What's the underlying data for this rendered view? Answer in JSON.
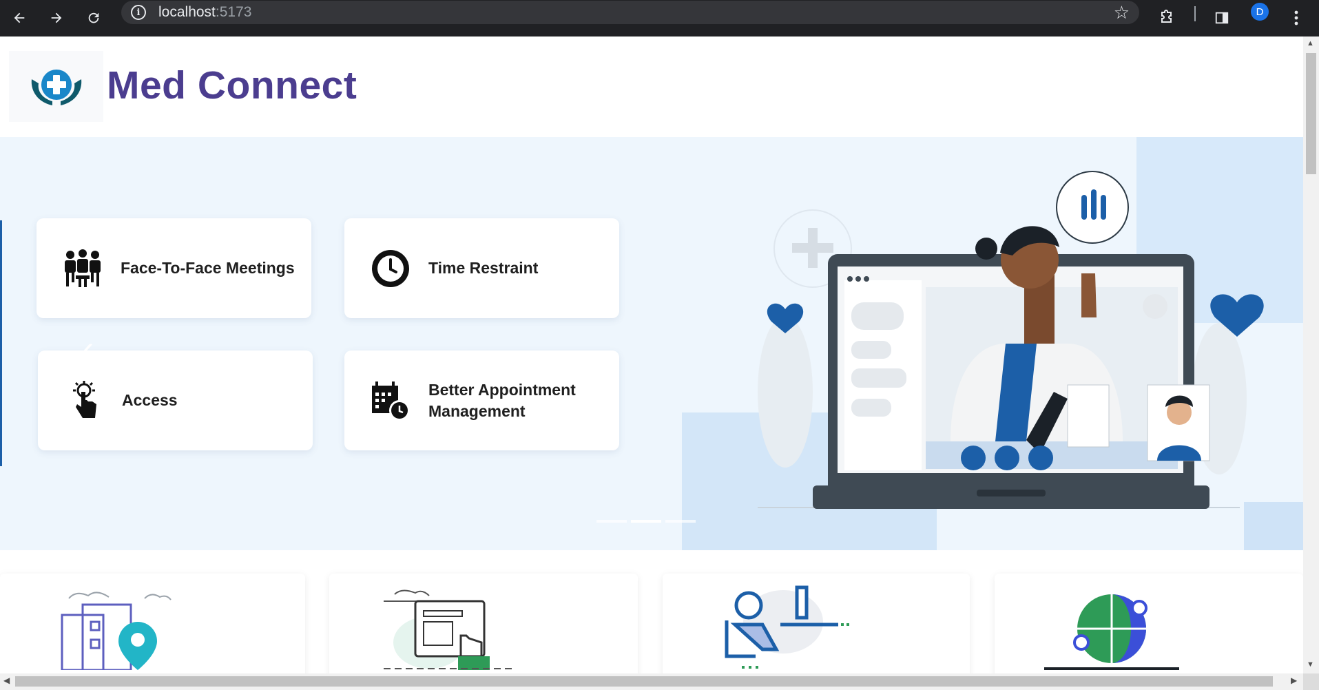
{
  "browser": {
    "url_host": "localhost",
    "url_port": ":5173",
    "profile_initial": "D",
    "icons": [
      "back-arrow-icon",
      "forward-arrow-icon",
      "reload-icon",
      "site-info-icon",
      "bookmark-star-icon",
      "extensions-icon",
      "side-panel-icon",
      "more-menu-icon"
    ]
  },
  "header": {
    "brand_name": "Med Connect",
    "logo_icon": "medical-cross-hands-icon"
  },
  "hero": {
    "features": [
      {
        "label": "Face-To-Face Meetings",
        "icon": "group-meeting-icon"
      },
      {
        "label": "Time Restraint",
        "icon": "clock-icon"
      },
      {
        "label": "Access",
        "icon": "touch-access-icon"
      },
      {
        "label": "Better Appointment Management",
        "icon": "calendar-clock-icon"
      }
    ],
    "illustration": "doctor-video-call-illustration",
    "slides": 3,
    "active_slide": 2,
    "colors": {
      "background": "#eef6fd",
      "accent": "#1c5fa8"
    }
  },
  "services": {
    "icons": [
      "clinic-location-icon",
      "online-booking-icon",
      "desk-worker-icon",
      "global-network-icon"
    ]
  },
  "colors": {
    "brand": "#4b3d8f",
    "primary_blue": "#1c5fa8"
  }
}
